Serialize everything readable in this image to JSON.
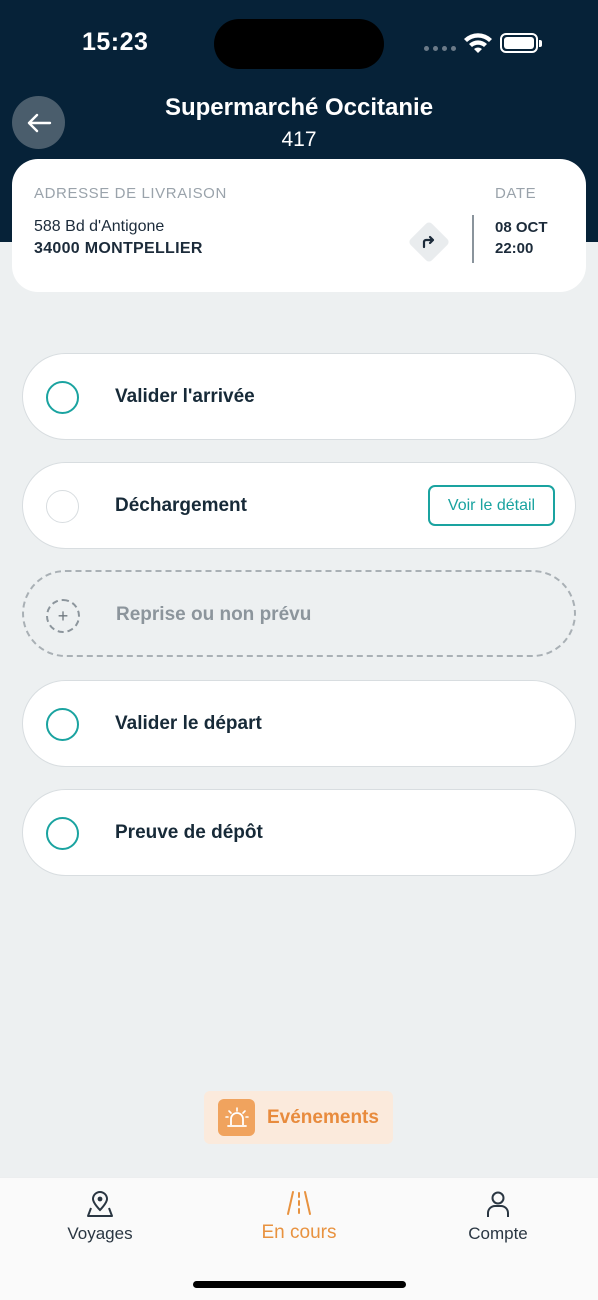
{
  "status_bar": {
    "time": "15:23"
  },
  "header": {
    "title": "Supermarché Occitanie",
    "subtitle": "417"
  },
  "address_card": {
    "address_label": "ADRESSE DE LIVRAISON",
    "address_line1": "588 Bd d'Antigone",
    "address_line2": "34000 MONTPELLIER",
    "date_label": "DATE",
    "date_day": "08 OCT",
    "date_time": "22:00"
  },
  "steps": [
    {
      "label": "Valider l'arrivée"
    },
    {
      "label": "Déchargement",
      "action": "Voir le détail"
    },
    {
      "label": "Reprise ou non prévu"
    },
    {
      "label": "Valider le départ"
    },
    {
      "label": "Preuve de dépôt"
    }
  ],
  "events_button": {
    "label": "Evénements"
  },
  "tabs": [
    {
      "label": "Voyages",
      "icon": "map-pin-icon"
    },
    {
      "label": "En cours",
      "icon": "road-icon",
      "active": true
    },
    {
      "label": "Compte",
      "icon": "user-icon"
    }
  ],
  "colors": {
    "header_bg": "#062238",
    "accent_teal": "#1aa3a0",
    "accent_orange": "#e8923f",
    "background": "#edf0f1"
  }
}
